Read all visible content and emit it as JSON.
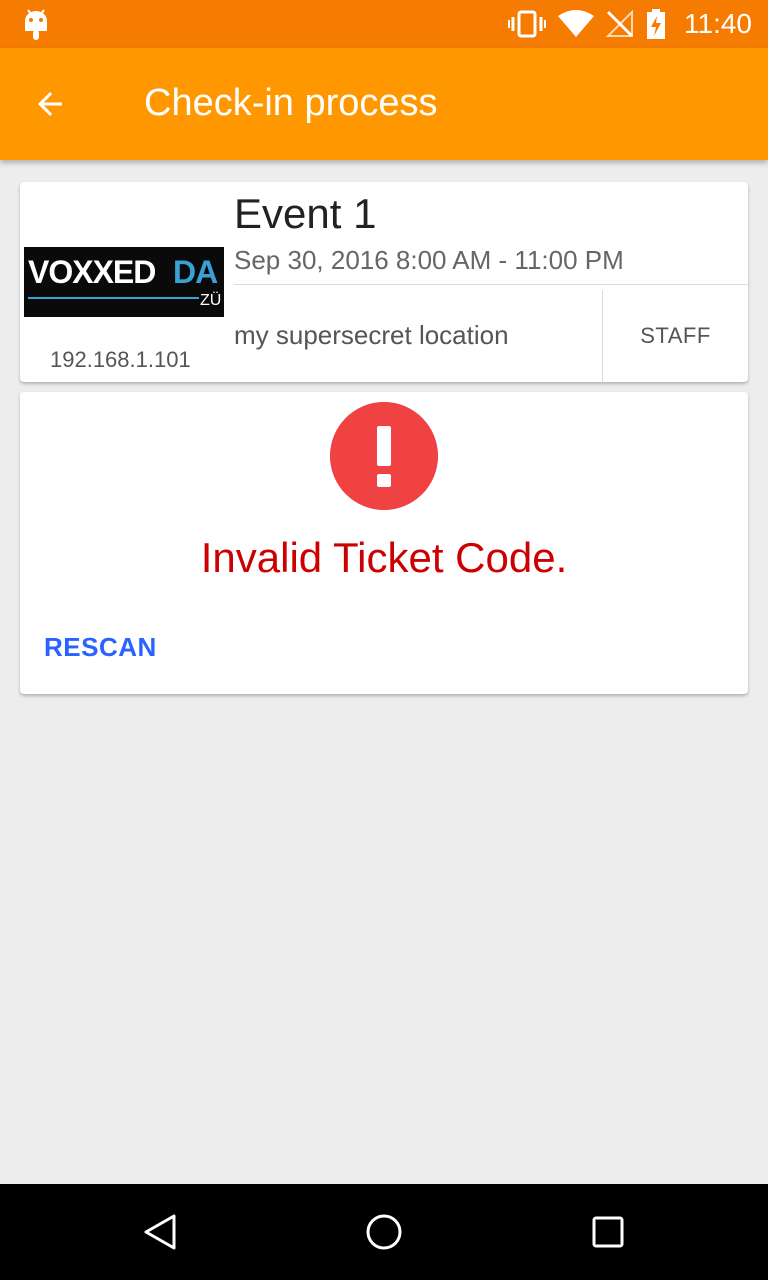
{
  "status_bar": {
    "time": "11:40",
    "icons": [
      "android-notification-icon",
      "vibrate-icon",
      "wifi-icon",
      "no-sim-icon",
      "battery-charging-icon"
    ]
  },
  "app_bar": {
    "title": "Check-in process",
    "back_icon": "arrow-back-icon"
  },
  "event": {
    "logo_text": "VOXXEDDA",
    "logo_sub": "ZÜ",
    "ip": "192.168.1.101",
    "title": "Event 1",
    "date": "Sep 30, 2016 8:00 AM - 11:00 PM",
    "location": "my supersecret location",
    "staff_label": "STAFF"
  },
  "result": {
    "icon": "error-icon",
    "message": "Invalid Ticket Code.",
    "rescan_label": "RESCAN"
  },
  "colors": {
    "status_bar": "#f57c00",
    "app_bar": "#ff9800",
    "error_red": "#cc0000",
    "error_circle": "#f04242",
    "link_blue": "#2962ff"
  },
  "nav_bar": {
    "buttons": [
      "back-triangle-icon",
      "home-circle-icon",
      "recents-square-icon"
    ]
  }
}
